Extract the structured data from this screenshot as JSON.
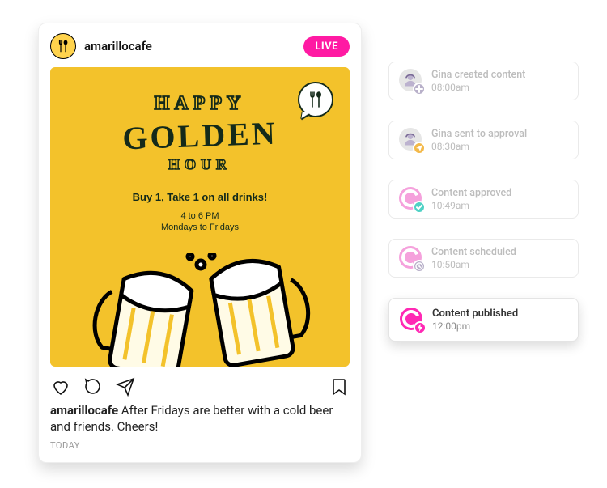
{
  "post": {
    "username": "amarillocafe",
    "live_label": "LIVE",
    "caption_author": "amarillocafe",
    "caption_text": " After Fridays are better with a cold beer and friends. Cheers!",
    "date_label": "TODAY",
    "icons": {
      "like": "heart-icon",
      "comment": "comment-icon",
      "share": "send-icon",
      "save": "bookmark-icon"
    },
    "flyer": {
      "line1": "HAPPY",
      "line2": "GOLDEN",
      "line3": "HOUR",
      "promo": "Buy 1, Take 1 on all drinks!",
      "time": "4 to 6 PM",
      "days": "Mondays to Fridays"
    }
  },
  "timeline": [
    {
      "id": "event-created",
      "title": "Gina created content",
      "time": "08:00am",
      "avatar_type": "person",
      "badge_color": "#b8b0c9",
      "badge_icon": "plus",
      "muted": true
    },
    {
      "id": "event-approval-sent",
      "title": "Gina sent to approval",
      "time": "08:30am",
      "avatar_type": "person",
      "badge_color": "#f3b94a",
      "badge_icon": "send",
      "muted": true
    },
    {
      "id": "event-approved",
      "title": "Content approved",
      "time": "10:49am",
      "avatar_type": "content",
      "badge_color": "#4fd1c5",
      "badge_icon": "check",
      "muted": true
    },
    {
      "id": "event-scheduled",
      "title": "Content scheduled",
      "time": "10:50am",
      "avatar_type": "content",
      "badge_color": "#b8b0c9",
      "badge_icon": "clock",
      "muted": true
    },
    {
      "id": "event-published",
      "title": "Content published",
      "time": "12:00pm",
      "avatar_type": "content",
      "badge_color": "#ff29b4",
      "badge_icon": "bolt",
      "muted": false
    }
  ],
  "colors": {
    "accent": "#ff1aa3",
    "flyer_bg": "#f3c22b",
    "flyer_fg": "#142a1a"
  }
}
